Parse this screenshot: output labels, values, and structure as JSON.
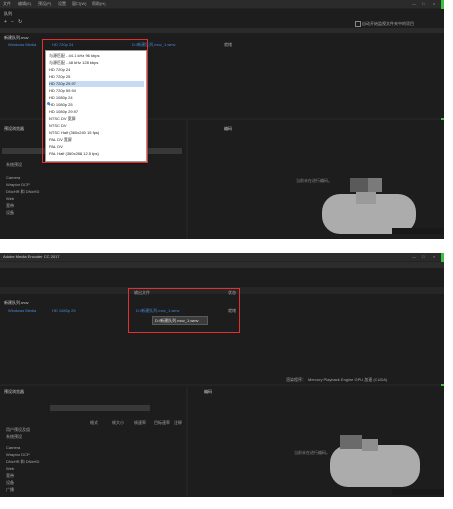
{
  "top": {
    "window_controls": [
      "—",
      "□",
      "×"
    ],
    "menu": [
      "文件",
      "编辑(E)",
      "预设(P)",
      "设置",
      "窗口(W)",
      "帮助(H)"
    ],
    "queue_button": "队列",
    "toolbar_icons": [
      "plus-icon",
      "minus-icon",
      "refresh-icon"
    ],
    "auto_start_label": "自动开始监视文件夹中的项目",
    "queue_item": "新建队列.mov",
    "format_value": "Windows Media",
    "preset_value": "HD 720p 24",
    "output_file": "D:/新建队列.mov_1.wmv",
    "status": "就绪",
    "renderer_label": "渲染程序：",
    "renderer_value": "Mercury Playback Engine GPU 加速 (CUDA)",
    "preset_browser_title": "预设浏览器",
    "preset_browser_items": [
      "系统预设",
      "Camera",
      "Wraptor DCP",
      "DNxHR 和 DNxHD",
      "Web",
      "宽带",
      "设备"
    ],
    "preview_title": "编码",
    "preview_status": "当前未在进行编码。",
    "dropdown_items": [
      "与源匹配 - 44.1 kHz 96 kbps",
      "与源匹配 - 48 kHz 128 kbps",
      "HD 720p 24",
      "HD 720p 25",
      "HD 720p 29.97",
      "HD 720p 59.94",
      "HD 1080p 24",
      "HD 1080p 25",
      "HD 1080p 29.97",
      "NTSC DV 宽屏",
      "NTSC DV",
      "NTSC Half (360x240 15 fps)",
      "PAL DV 宽屏",
      "PAL DV",
      "PAL Half (360x288 12.5 fps)"
    ],
    "dropdown_selected_index": 4
  },
  "bottom": {
    "app_title": "Adobe Media Encoder CC 2017",
    "window_controls": [
      "—",
      "□",
      "×"
    ],
    "queue_item": "新建队列.mov",
    "format_value": "Windows Media",
    "preset_value": "HD 1080p 25",
    "output_header": "输出文件",
    "output_file": "D:/新建队列.mov_1.wmv",
    "tooltip": "D:/新建队列.mov_1.wmv",
    "status_header": "状态",
    "status": "就绪",
    "renderer_label": "渲染程序：",
    "renderer_value": "Mercury Playback Engine GPU 加速 (CUDA)",
    "preset_browser_title": "预设浏览器",
    "preset_browser_headers": [
      "格式",
      "帧大小",
      "帧速率",
      "目标速率",
      "注释"
    ],
    "preset_browser_items": [
      "用户预设及组",
      "系统预设",
      "Camera",
      "Wraptor DCP",
      "DNxHR 和 DNxHD",
      "Web",
      "宽带",
      "设备",
      "广播"
    ],
    "preview_title": "编码",
    "preview_status": "当前未在进行编码。"
  }
}
